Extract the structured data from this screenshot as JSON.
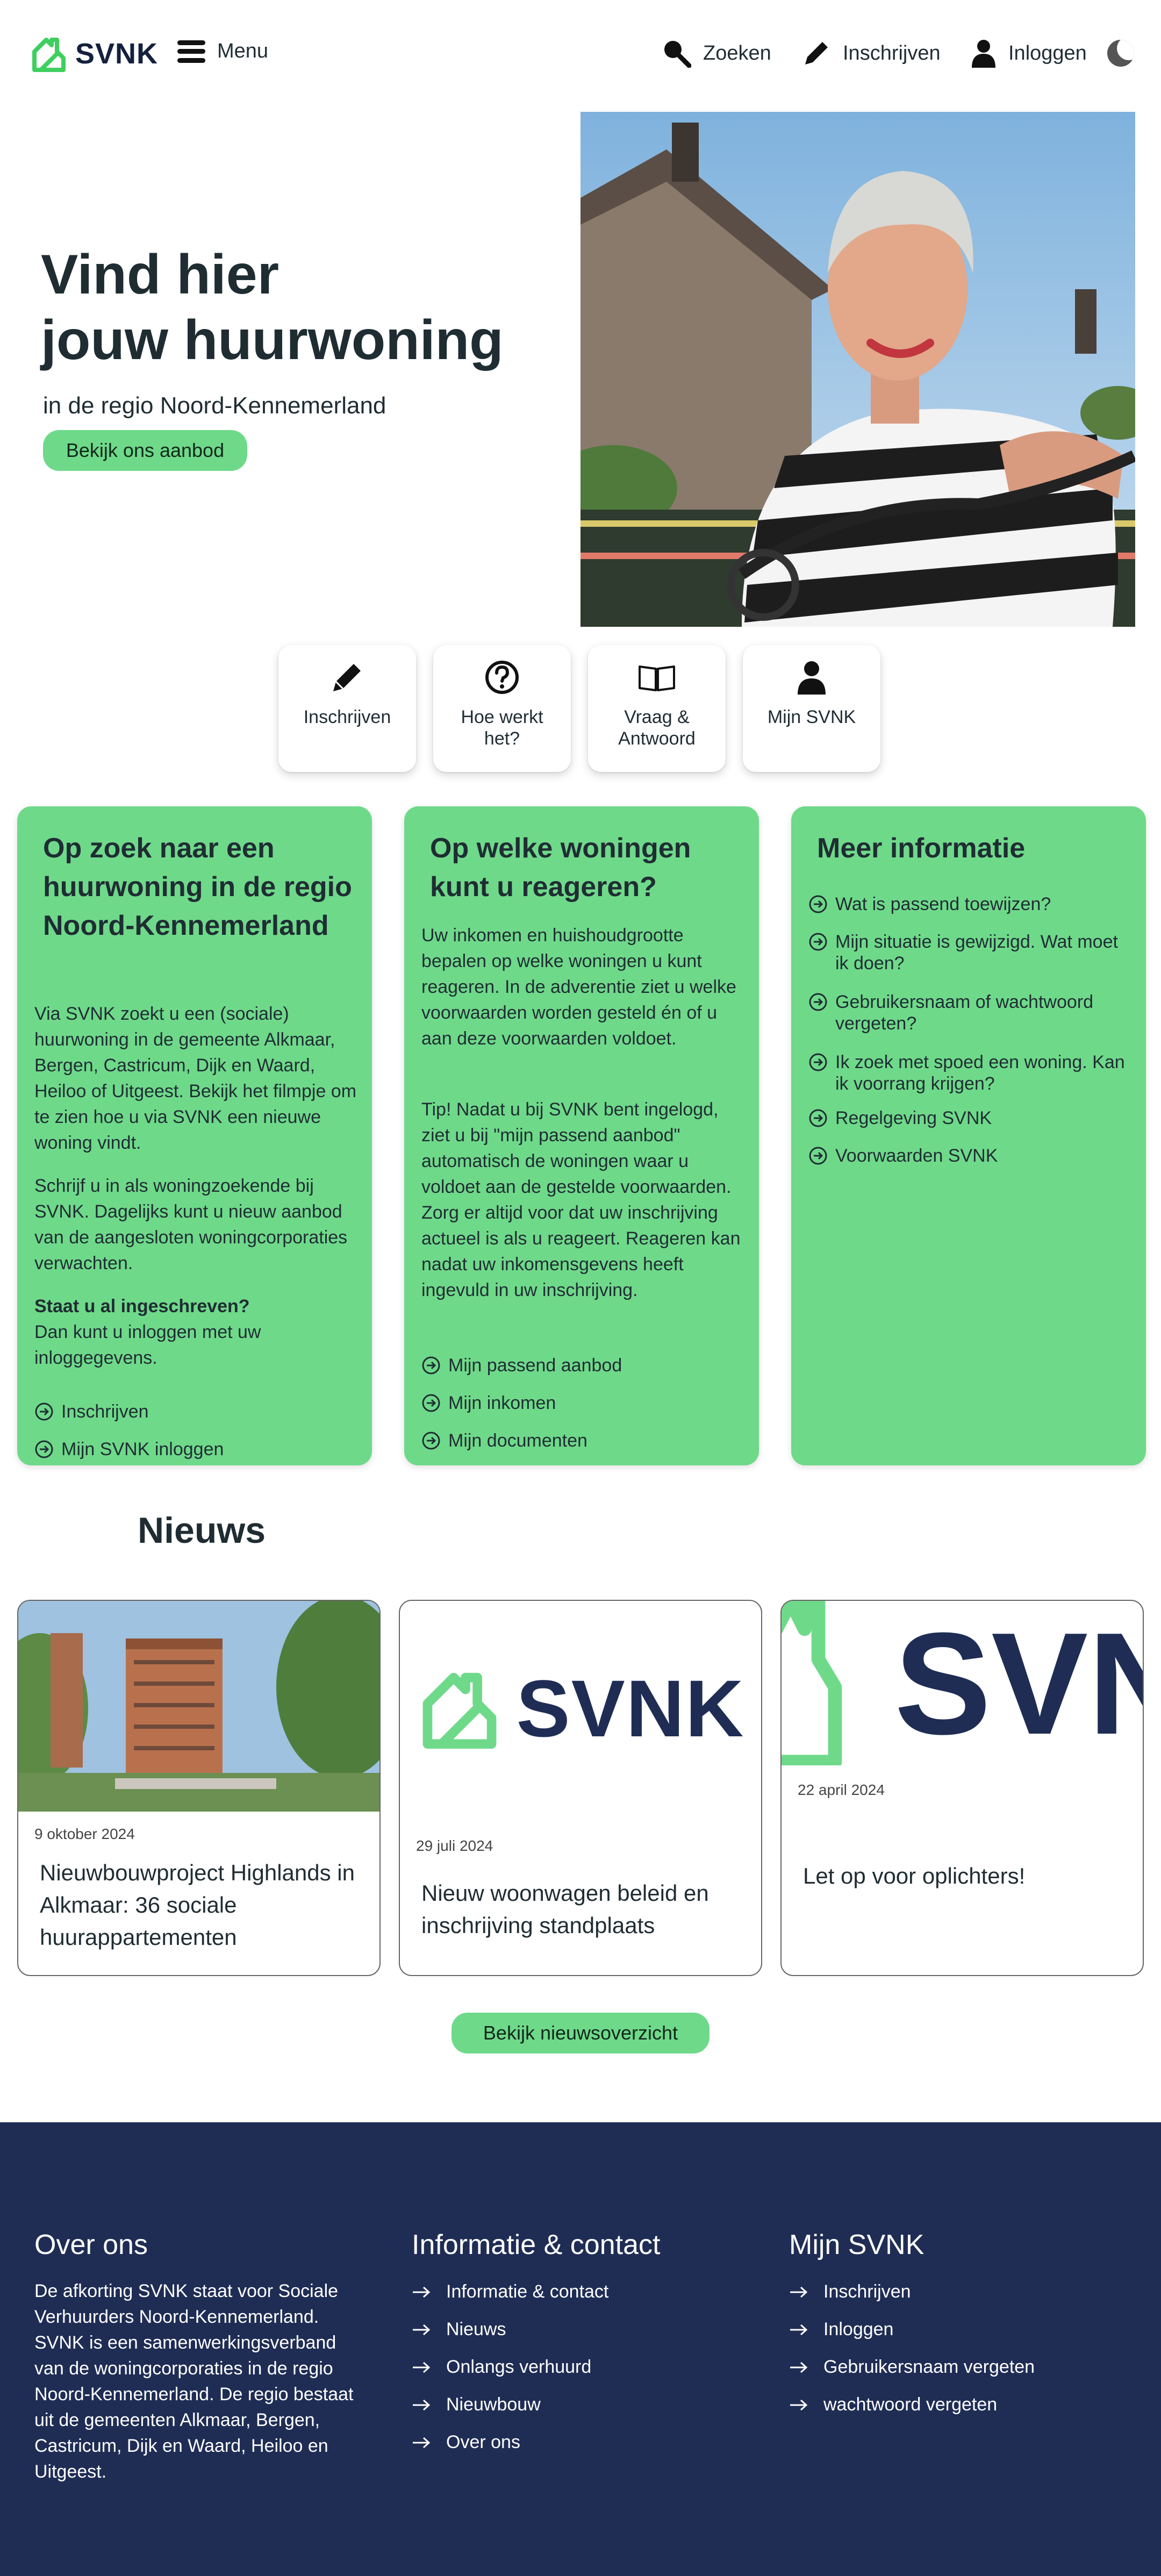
{
  "header": {
    "logo_text": "SVNK",
    "menu_label": "Menu",
    "nav": {
      "search": "Zoeken",
      "register": "Inschrijven",
      "login": "Inloggen"
    }
  },
  "hero": {
    "title_line1": "Vind hier",
    "title_line2": "jouw huurwoning",
    "subtitle": "in de regio Noord-Kennemerland",
    "button": "Bekijk ons aanbod"
  },
  "tiles": [
    {
      "label": "Inschrijven",
      "icon": "pencil-icon"
    },
    {
      "label": "Hoe werkt\nhet?",
      "icon": "question-circle-icon"
    },
    {
      "label": "Vraag &\nAntwoord",
      "icon": "book-icon"
    },
    {
      "label": "Mijn SVNK",
      "icon": "user-icon"
    }
  ],
  "cards": {
    "search": {
      "title": "Op zoek naar een huurwoning in de regio Noord-Kennemerland",
      "p1": "Via SVNK zoekt u een (sociale) huurwoning in de gemeente Alkmaar, Bergen, Castricum, Dijk en Waard, Heiloo of Uitgeest. Bekijk het filmpje om te zien hoe u via SVNK een nieuwe woning vindt.",
      "p2": "Schrijf u in als woningzoekende bij SVNK. Dagelijks kunt u nieuw aanbod van de aangesloten woningcorporaties verwachten.",
      "p3_bold": "Staat u al ingeschreven?",
      "p3": "Dan kunt u inloggen met uw inloggegevens.",
      "links": [
        "Inschrijven",
        "Mijn SVNK inloggen"
      ]
    },
    "react": {
      "title": "Op welke woningen kunt u reageren?",
      "p1": "Uw inkomen en huishoudgrootte bepalen op welke woningen u kunt reageren. In de adverentie ziet u welke voorwaarden worden gesteld én of u aan deze voorwaarden voldoet.",
      "p2": "Tip! Nadat u bij SVNK bent ingelogd, ziet u bij \"mijn passend aanbod\" automatisch de woningen waar u voldoet aan de gestelde voorwaarden. Zorg er altijd voor dat uw inschrijving actueel is als u reageert. Reageren kan nadat uw inkomensgevens heeft ingevuld in uw inschrijving.",
      "links": [
        "Mijn passend aanbod",
        "Mijn inkomen",
        "Mijn documenten"
      ]
    },
    "info": {
      "title": "Meer informatie",
      "links": [
        "Wat is passend toewijzen?",
        "Mijn situatie is gewijzigd. Wat moet ik doen?",
        "Gebruikersnaam of wachtwoord vergeten?",
        "Ik zoek met spoed een woning. Kan ik voorrang krijgen?",
        "Regelgeving SVNK",
        "Voorwaarden SVNK"
      ]
    }
  },
  "news": {
    "heading": "Nieuws",
    "items": [
      {
        "date": "9 oktober 2024",
        "title": "Nieuwbouwproject Highlands in Alkmaar: 36 sociale huurappartementen"
      },
      {
        "date": "29 juli 2024",
        "logo_text": "SVNK",
        "title": "Nieuw woonwagen beleid en inschrijving standplaats"
      },
      {
        "date": "22 april 2024",
        "logo_text": "SVN",
        "title": "Let op voor oplichters!"
      }
    ],
    "button": "Bekijk nieuwsoverzicht"
  },
  "footer": {
    "about_title": "Over ons",
    "about_text": "De afkorting SVNK staat voor Sociale Verhuurders Noord-Kennemerland. SVNK is een samenwerkingsverband van de woningcorporaties in de regio Noord-Kennemerland. De regio bestaat uit de gemeenten Alkmaar, Bergen, Castricum, Dijk en Waard, Heiloo en Uitgeest.",
    "contact_title": "Informatie & contact",
    "contact_links": [
      "Informatie & contact",
      "Nieuws",
      "Onlangs verhuurd",
      "Nieuwbouw",
      "Over ons"
    ],
    "mine_title": "Mijn SVNK",
    "mine_links": [
      "Inschrijven",
      "Inloggen",
      "Gebruikersnaam vergeten",
      "wachtwoord vergeten"
    ]
  },
  "colors": {
    "brand_green": "#6fd98a",
    "navy": "#1f2d55",
    "text": "#1f2d33"
  }
}
